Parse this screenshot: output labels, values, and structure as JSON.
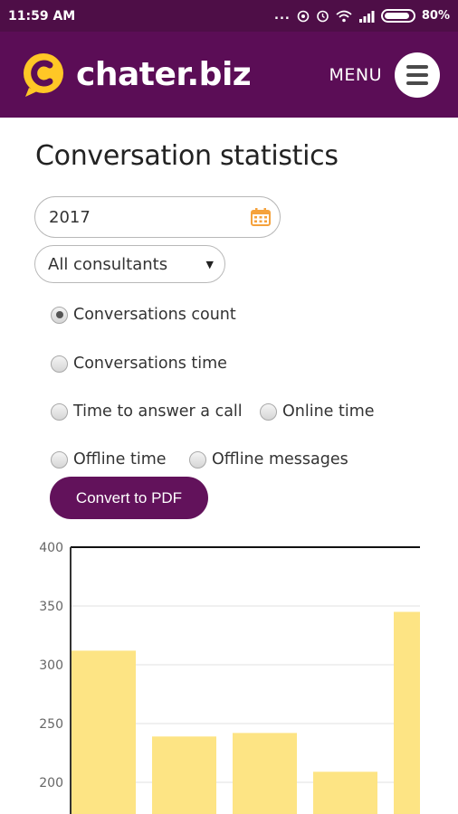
{
  "status_bar": {
    "time": "11:59 AM",
    "dots": "...",
    "battery": "80%"
  },
  "header": {
    "brand": "chater.biz",
    "menu_label": "MENU"
  },
  "page": {
    "title": "Conversation statistics"
  },
  "filters": {
    "year": "2017",
    "consultant": "All consultants"
  },
  "options": [
    {
      "label": "Conversations count",
      "checked": true
    },
    {
      "label": "Conversations time",
      "checked": false
    },
    {
      "label": "Time to answer a call",
      "checked": false
    },
    {
      "label": "Online time",
      "checked": false
    },
    {
      "label": "Offline time",
      "checked": false
    },
    {
      "label": "Offline messages",
      "checked": false
    }
  ],
  "actions": {
    "convert_pdf": "Convert to PDF"
  },
  "colors": {
    "brand_purple": "#5b0d56",
    "accent_yellow": "#ffc726",
    "bar_fill": "#fde484",
    "calendar_orange": "#f5a23c"
  },
  "chart_data": {
    "type": "bar",
    "y_ticks": [
      "400",
      "350",
      "300",
      "250",
      "200"
    ],
    "ylim": [
      200,
      400
    ],
    "values": [
      312,
      239,
      242,
      209,
      345
    ],
    "grid": true
  }
}
